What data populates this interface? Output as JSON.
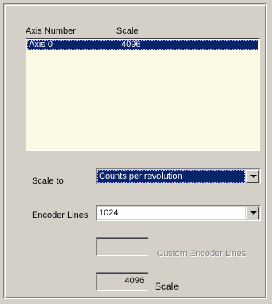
{
  "list": {
    "columns": [
      "Axis Number",
      "Scale"
    ],
    "rows": [
      {
        "axis": "Axis 0",
        "scale": "4096",
        "selected": true
      }
    ]
  },
  "scale_to": {
    "label": "Scale to",
    "value": "Counts per revolution"
  },
  "encoder_lines": {
    "label": "Encoder Lines",
    "value": "1024"
  },
  "custom_encoder_lines": {
    "label": "Custom Encoder Lines",
    "value": ""
  },
  "scale": {
    "label": "Scale",
    "value": "4096"
  },
  "colors": {
    "face": "#d4d0c8",
    "list_bg": "#fbf8e3",
    "selection": "#0a246a",
    "disabled_text": "#808080"
  }
}
